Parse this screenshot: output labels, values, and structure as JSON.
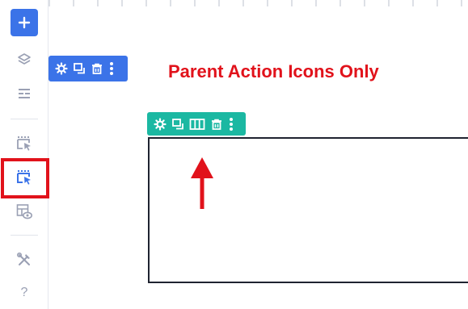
{
  "caption": "Parent Action Icons Only",
  "sidebar": {
    "items": [
      {
        "name": "add",
        "icon": "plus-icon"
      },
      {
        "name": "layers",
        "icon": "layers-icon"
      },
      {
        "name": "sections",
        "icon": "sections-icon"
      },
      {
        "name": "select-parent",
        "icon": "dotted-select-icon"
      },
      {
        "name": "select-parent-active",
        "icon": "dotted-select-filled-icon",
        "highlighted": true
      },
      {
        "name": "preview",
        "icon": "layout-eye-icon"
      },
      {
        "name": "tools",
        "icon": "wrench-screwdriver-icon"
      },
      {
        "name": "help",
        "icon": "question-icon",
        "label": "?"
      }
    ]
  },
  "parent_toolbar": {
    "color": "#3b73e8",
    "icons": [
      "gear-icon",
      "duplicate-icon",
      "trash-icon",
      "more-vertical-icon"
    ]
  },
  "child_toolbar": {
    "color": "#1bb8a2",
    "icons": [
      "gear-icon",
      "duplicate-icon",
      "columns-icon",
      "trash-icon",
      "more-vertical-icon"
    ]
  },
  "colors": {
    "annotation_red": "#e1121b",
    "primary_blue": "#3b73e8",
    "teal": "#1bb8a2",
    "icon_gray": "#9aa0b4"
  }
}
